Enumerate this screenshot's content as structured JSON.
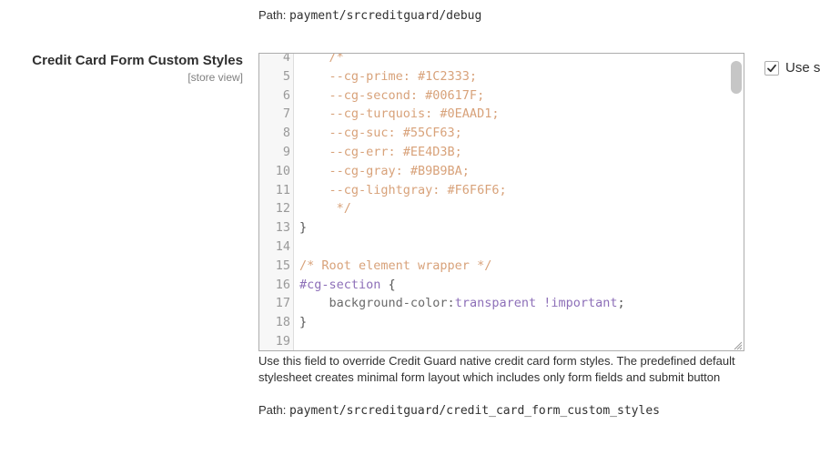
{
  "debug_path": {
    "label": "Path:",
    "value": "payment/srcreditguard/debug"
  },
  "field": {
    "title": "Credit Card Form Custom Styles",
    "scope": "[store view]",
    "checkbox_label": "Use s",
    "checkbox_checked": true
  },
  "editor": {
    "lines": [
      {
        "n": "4",
        "t": [
          [
            "c-comment",
            "    /*"
          ]
        ]
      },
      {
        "n": "5",
        "t": [
          [
            "c-comment",
            "    --cg-prime: #1C2333;"
          ]
        ]
      },
      {
        "n": "6",
        "t": [
          [
            "c-comment",
            "    --cg-second: #00617F;"
          ]
        ]
      },
      {
        "n": "7",
        "t": [
          [
            "c-comment",
            "    --cg-turquois: #0EAAD1;"
          ]
        ]
      },
      {
        "n": "8",
        "t": [
          [
            "c-comment",
            "    --cg-suc: #55CF63;"
          ]
        ]
      },
      {
        "n": "9",
        "t": [
          [
            "c-comment",
            "    --cg-err: #EE4D3B;"
          ]
        ]
      },
      {
        "n": "10",
        "t": [
          [
            "c-comment",
            "    --cg-gray: #B9B9BA;"
          ]
        ]
      },
      {
        "n": "11",
        "t": [
          [
            "c-comment",
            "    --cg-lightgray: #F6F6F6;"
          ]
        ]
      },
      {
        "n": "12",
        "t": [
          [
            "c-comment",
            "     */"
          ]
        ]
      },
      {
        "n": "13",
        "t": [
          [
            "c-punc",
            "}"
          ]
        ]
      },
      {
        "n": "14",
        "t": []
      },
      {
        "n": "15",
        "t": [
          [
            "c-comment",
            "/* Root element wrapper */"
          ]
        ]
      },
      {
        "n": "16",
        "t": [
          [
            "c-sel",
            "#cg-section"
          ],
          [
            "c-punc",
            " {"
          ]
        ]
      },
      {
        "n": "17",
        "t": [
          [
            "c-prop",
            "    background-color:"
          ],
          [
            "c-kw",
            "transparent !important"
          ],
          [
            "c-punc",
            ";"
          ]
        ]
      },
      {
        "n": "18",
        "t": [
          [
            "c-punc",
            "}"
          ]
        ]
      },
      {
        "n": "19",
        "t": []
      }
    ]
  },
  "note": {
    "text": "Use this field to override Credit Guard native credit card form styles. The predefined default stylesheet creates minimal form layout which includes only form fields and submit button",
    "path_label": "Path:",
    "path_value": "payment/srcreditguard/credit_card_form_custom_styles"
  }
}
